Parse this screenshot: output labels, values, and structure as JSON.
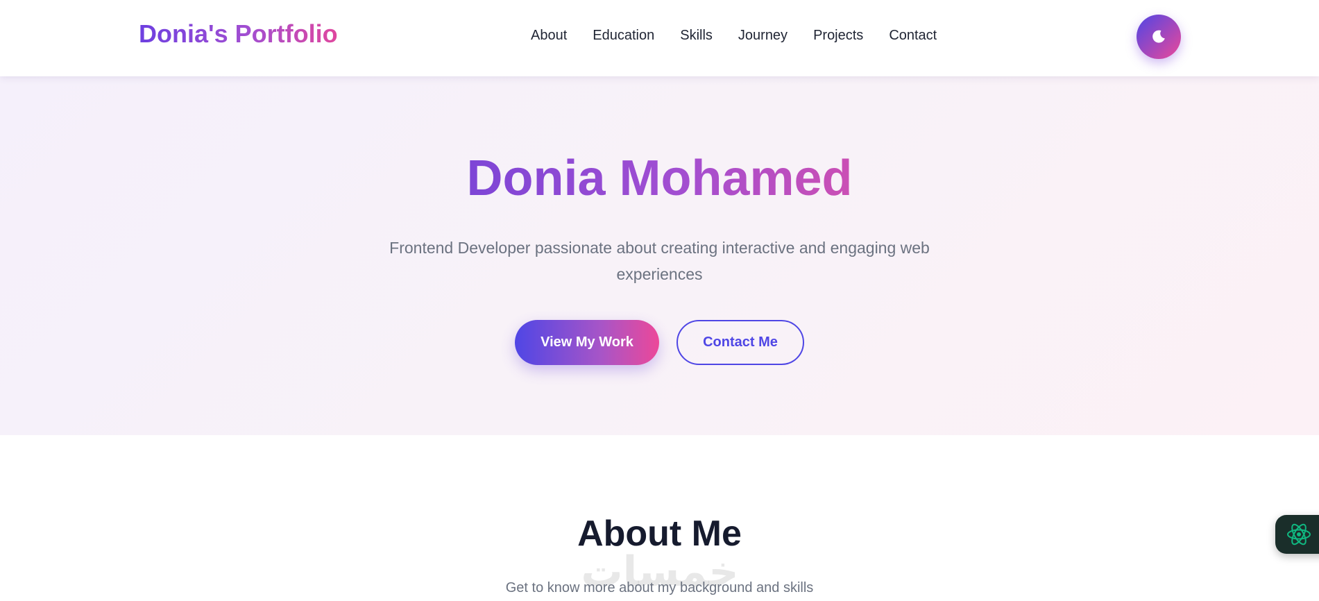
{
  "header": {
    "logo": "Donia's Portfolio",
    "nav": [
      "About",
      "Education",
      "Skills",
      "Journey",
      "Projects",
      "Contact"
    ],
    "theme_toggle_icon": "moon-icon"
  },
  "hero": {
    "name": "Donia Mohamed",
    "subtitle": "Frontend Developer passionate about creating interactive and engaging web experiences",
    "primary_button": "View My Work",
    "secondary_button": "Contact Me"
  },
  "about": {
    "title": "About Me",
    "watermark": "خمسات",
    "subtitle": "Get to know more about my background and skills"
  },
  "floating_widget": {
    "icon": "atom-icon"
  },
  "colors": {
    "brand_start": "#4f46e5",
    "brand_end": "#ec4899",
    "text_dark": "#161b2e",
    "text_muted": "#6b7280",
    "widget_bg": "#1a2e2a",
    "widget_icon": "#10b981"
  }
}
